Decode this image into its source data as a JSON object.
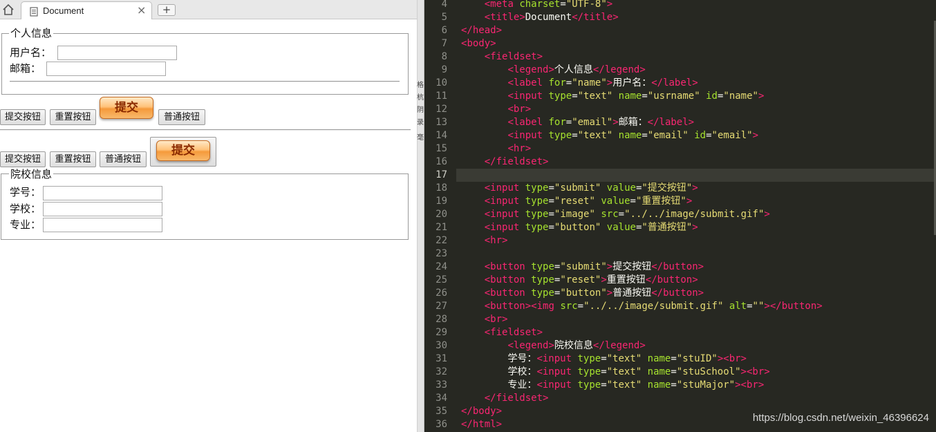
{
  "browser": {
    "tab_title": "Document",
    "tab_close": "×",
    "new_tab": "+",
    "page": {
      "personal": {
        "legend": "个人信息",
        "username_label": "用户名：",
        "username_value": "",
        "email_label": "邮箱：",
        "email_value": ""
      },
      "row1": {
        "submit": "提交按钮",
        "reset": "重置按钮",
        "image_text": "提交",
        "button": "普通按钮"
      },
      "row2": {
        "submit": "提交按钮",
        "reset": "重置按钮",
        "button": "普通按钮",
        "image_text": "提交"
      },
      "school": {
        "legend": "院校信息",
        "id_label": "学号：",
        "id_value": "",
        "school_label": "学校：",
        "school_value": "",
        "major_label": "专业：",
        "major_value": ""
      }
    }
  },
  "strip": [
    "格",
    "杭",
    "阴",
    "录",
    "毫"
  ],
  "editor": {
    "line_numbers": [
      "4",
      "5",
      "6",
      "7",
      "8",
      "9",
      "10",
      "11",
      "12",
      "13",
      "14",
      "15",
      "16",
      "17",
      "18",
      "19",
      "20",
      "21",
      "22",
      "23",
      "24",
      "25",
      "26",
      "27",
      "28",
      "29",
      "30",
      "31",
      "32",
      "33",
      "34",
      "35",
      "36"
    ],
    "active_line": "17",
    "lines": [
      [
        [
          "    ",
          "w"
        ],
        [
          "<",
          "tag"
        ],
        [
          "meta",
          "tag"
        ],
        [
          " ",
          "w"
        ],
        [
          "charset",
          "attr"
        ],
        [
          "=",
          "w"
        ],
        [
          "\"UTF-8\"",
          "str"
        ],
        [
          ">",
          "tag"
        ]
      ],
      [
        [
          "    ",
          "w"
        ],
        [
          "<",
          "tag"
        ],
        [
          "title",
          "tag"
        ],
        [
          ">",
          "tag"
        ],
        [
          "Document",
          "w"
        ],
        [
          "</",
          "tag"
        ],
        [
          "title",
          "tag"
        ],
        [
          ">",
          "tag"
        ]
      ],
      [
        [
          "</",
          "tag"
        ],
        [
          "head",
          "tag"
        ],
        [
          ">",
          "tag"
        ]
      ],
      [
        [
          "<",
          "tag"
        ],
        [
          "body",
          "tag"
        ],
        [
          ">",
          "tag"
        ]
      ],
      [
        [
          "    ",
          "w"
        ],
        [
          "<",
          "tag"
        ],
        [
          "fieldset",
          "tag"
        ],
        [
          ">",
          "tag"
        ]
      ],
      [
        [
          "        ",
          "w"
        ],
        [
          "<",
          "tag"
        ],
        [
          "legend",
          "tag"
        ],
        [
          ">",
          "tag"
        ],
        [
          "个人信息",
          "w"
        ],
        [
          "</",
          "tag"
        ],
        [
          "legend",
          "tag"
        ],
        [
          ">",
          "tag"
        ]
      ],
      [
        [
          "        ",
          "w"
        ],
        [
          "<",
          "tag"
        ],
        [
          "label",
          "tag"
        ],
        [
          " ",
          "w"
        ],
        [
          "for",
          "attr"
        ],
        [
          "=",
          "w"
        ],
        [
          "\"name\"",
          "str"
        ],
        [
          ">",
          "tag"
        ],
        [
          "用户名：",
          "w"
        ],
        [
          "</",
          "tag"
        ],
        [
          "label",
          "tag"
        ],
        [
          ">",
          "tag"
        ]
      ],
      [
        [
          "        ",
          "w"
        ],
        [
          "<",
          "tag"
        ],
        [
          "input",
          "tag"
        ],
        [
          " ",
          "w"
        ],
        [
          "type",
          "attr"
        ],
        [
          "=",
          "w"
        ],
        [
          "\"text\"",
          "str"
        ],
        [
          " ",
          "w"
        ],
        [
          "name",
          "attr"
        ],
        [
          "=",
          "w"
        ],
        [
          "\"usrname\"",
          "str"
        ],
        [
          " ",
          "w"
        ],
        [
          "id",
          "attr"
        ],
        [
          "=",
          "w"
        ],
        [
          "\"name\"",
          "str"
        ],
        [
          ">",
          "tag"
        ]
      ],
      [
        [
          "        ",
          "w"
        ],
        [
          "<",
          "tag"
        ],
        [
          "br",
          "tag"
        ],
        [
          ">",
          "tag"
        ]
      ],
      [
        [
          "        ",
          "w"
        ],
        [
          "<",
          "tag"
        ],
        [
          "label",
          "tag"
        ],
        [
          " ",
          "w"
        ],
        [
          "for",
          "attr"
        ],
        [
          "=",
          "w"
        ],
        [
          "\"email\"",
          "str"
        ],
        [
          ">",
          "tag"
        ],
        [
          "邮箱：",
          "w"
        ],
        [
          "</",
          "tag"
        ],
        [
          "label",
          "tag"
        ],
        [
          ">",
          "tag"
        ]
      ],
      [
        [
          "        ",
          "w"
        ],
        [
          "<",
          "tag"
        ],
        [
          "input",
          "tag"
        ],
        [
          " ",
          "w"
        ],
        [
          "type",
          "attr"
        ],
        [
          "=",
          "w"
        ],
        [
          "\"text\"",
          "str"
        ],
        [
          " ",
          "w"
        ],
        [
          "name",
          "attr"
        ],
        [
          "=",
          "w"
        ],
        [
          "\"email\"",
          "str"
        ],
        [
          " ",
          "w"
        ],
        [
          "id",
          "attr"
        ],
        [
          "=",
          "w"
        ],
        [
          "\"email\"",
          "str"
        ],
        [
          ">",
          "tag"
        ]
      ],
      [
        [
          "        ",
          "w"
        ],
        [
          "<",
          "tag"
        ],
        [
          "hr",
          "tag"
        ],
        [
          ">",
          "tag"
        ]
      ],
      [
        [
          "    ",
          "w"
        ],
        [
          "</",
          "tag"
        ],
        [
          "fieldset",
          "tag"
        ],
        [
          ">",
          "tag"
        ]
      ],
      [],
      [
        [
          "    ",
          "w"
        ],
        [
          "<",
          "tag"
        ],
        [
          "input",
          "tag"
        ],
        [
          " ",
          "w"
        ],
        [
          "type",
          "attr"
        ],
        [
          "=",
          "w"
        ],
        [
          "\"submit\"",
          "str"
        ],
        [
          " ",
          "w"
        ],
        [
          "value",
          "attr"
        ],
        [
          "=",
          "w"
        ],
        [
          "\"提交按钮\"",
          "str"
        ],
        [
          ">",
          "tag"
        ]
      ],
      [
        [
          "    ",
          "w"
        ],
        [
          "<",
          "tag"
        ],
        [
          "input",
          "tag"
        ],
        [
          " ",
          "w"
        ],
        [
          "type",
          "attr"
        ],
        [
          "=",
          "w"
        ],
        [
          "\"reset\"",
          "str"
        ],
        [
          " ",
          "w"
        ],
        [
          "value",
          "attr"
        ],
        [
          "=",
          "w"
        ],
        [
          "\"重置按钮\"",
          "str"
        ],
        [
          ">",
          "tag"
        ]
      ],
      [
        [
          "    ",
          "w"
        ],
        [
          "<",
          "tag"
        ],
        [
          "input",
          "tag"
        ],
        [
          " ",
          "w"
        ],
        [
          "type",
          "attr"
        ],
        [
          "=",
          "w"
        ],
        [
          "\"image\"",
          "str"
        ],
        [
          " ",
          "w"
        ],
        [
          "src",
          "attr"
        ],
        [
          "=",
          "w"
        ],
        [
          "\"../../image/submit.gif\"",
          "str"
        ],
        [
          ">",
          "tag"
        ]
      ],
      [
        [
          "    ",
          "w"
        ],
        [
          "<",
          "tag"
        ],
        [
          "input",
          "tag"
        ],
        [
          " ",
          "w"
        ],
        [
          "type",
          "attr"
        ],
        [
          "=",
          "w"
        ],
        [
          "\"button\"",
          "str"
        ],
        [
          " ",
          "w"
        ],
        [
          "value",
          "attr"
        ],
        [
          "=",
          "w"
        ],
        [
          "\"普通按钮\"",
          "str"
        ],
        [
          ">",
          "tag"
        ]
      ],
      [
        [
          "    ",
          "w"
        ],
        [
          "<",
          "tag"
        ],
        [
          "hr",
          "tag"
        ],
        [
          ">",
          "tag"
        ]
      ],
      [],
      [
        [
          "    ",
          "w"
        ],
        [
          "<",
          "tag"
        ],
        [
          "button",
          "tag"
        ],
        [
          " ",
          "w"
        ],
        [
          "type",
          "attr"
        ],
        [
          "=",
          "w"
        ],
        [
          "\"submit\"",
          "str"
        ],
        [
          ">",
          "tag"
        ],
        [
          "提交按钮",
          "w"
        ],
        [
          "</",
          "tag"
        ],
        [
          "button",
          "tag"
        ],
        [
          ">",
          "tag"
        ]
      ],
      [
        [
          "    ",
          "w"
        ],
        [
          "<",
          "tag"
        ],
        [
          "button",
          "tag"
        ],
        [
          " ",
          "w"
        ],
        [
          "type",
          "attr"
        ],
        [
          "=",
          "w"
        ],
        [
          "\"reset\"",
          "str"
        ],
        [
          ">",
          "tag"
        ],
        [
          "重置按钮",
          "w"
        ],
        [
          "</",
          "tag"
        ],
        [
          "button",
          "tag"
        ],
        [
          ">",
          "tag"
        ]
      ],
      [
        [
          "    ",
          "w"
        ],
        [
          "<",
          "tag"
        ],
        [
          "button",
          "tag"
        ],
        [
          " ",
          "w"
        ],
        [
          "type",
          "attr"
        ],
        [
          "=",
          "w"
        ],
        [
          "\"button\"",
          "str"
        ],
        [
          ">",
          "tag"
        ],
        [
          "普通按钮",
          "w"
        ],
        [
          "</",
          "tag"
        ],
        [
          "button",
          "tag"
        ],
        [
          ">",
          "tag"
        ]
      ],
      [
        [
          "    ",
          "w"
        ],
        [
          "<",
          "tag"
        ],
        [
          "button",
          "tag"
        ],
        [
          ">",
          "tag"
        ],
        [
          "<",
          "tag"
        ],
        [
          "img",
          "tag"
        ],
        [
          " ",
          "w"
        ],
        [
          "src",
          "attr"
        ],
        [
          "=",
          "w"
        ],
        [
          "\"../../image/submit.gif\"",
          "str"
        ],
        [
          " ",
          "w"
        ],
        [
          "alt",
          "attr"
        ],
        [
          "=",
          "w"
        ],
        [
          "\"\"",
          "str"
        ],
        [
          ">",
          "tag"
        ],
        [
          "</",
          "tag"
        ],
        [
          "button",
          "tag"
        ],
        [
          ">",
          "tag"
        ]
      ],
      [
        [
          "    ",
          "w"
        ],
        [
          "<",
          "tag"
        ],
        [
          "br",
          "tag"
        ],
        [
          ">",
          "tag"
        ]
      ],
      [
        [
          "    ",
          "w"
        ],
        [
          "<",
          "tag"
        ],
        [
          "fieldset",
          "tag"
        ],
        [
          ">",
          "tag"
        ]
      ],
      [
        [
          "        ",
          "w"
        ],
        [
          "<",
          "tag"
        ],
        [
          "legend",
          "tag"
        ],
        [
          ">",
          "tag"
        ],
        [
          "院校信息",
          "w"
        ],
        [
          "</",
          "tag"
        ],
        [
          "legend",
          "tag"
        ],
        [
          ">",
          "tag"
        ]
      ],
      [
        [
          "        ",
          "w"
        ],
        [
          "学号：",
          "w"
        ],
        [
          "<",
          "tag"
        ],
        [
          "input",
          "tag"
        ],
        [
          " ",
          "w"
        ],
        [
          "type",
          "attr"
        ],
        [
          "=",
          "w"
        ],
        [
          "\"text\"",
          "str"
        ],
        [
          " ",
          "w"
        ],
        [
          "name",
          "attr"
        ],
        [
          "=",
          "w"
        ],
        [
          "\"stuID\"",
          "str"
        ],
        [
          ">",
          "tag"
        ],
        [
          "<",
          "tag"
        ],
        [
          "br",
          "tag"
        ],
        [
          ">",
          "tag"
        ]
      ],
      [
        [
          "        ",
          "w"
        ],
        [
          "学校：",
          "w"
        ],
        [
          "<",
          "tag"
        ],
        [
          "input",
          "tag"
        ],
        [
          " ",
          "w"
        ],
        [
          "type",
          "attr"
        ],
        [
          "=",
          "w"
        ],
        [
          "\"text\"",
          "str"
        ],
        [
          " ",
          "w"
        ],
        [
          "name",
          "attr"
        ],
        [
          "=",
          "w"
        ],
        [
          "\"stuSchool\"",
          "str"
        ],
        [
          ">",
          "tag"
        ],
        [
          "<",
          "tag"
        ],
        [
          "br",
          "tag"
        ],
        [
          ">",
          "tag"
        ]
      ],
      [
        [
          "        ",
          "w"
        ],
        [
          "专业：",
          "w"
        ],
        [
          "<",
          "tag"
        ],
        [
          "input",
          "tag"
        ],
        [
          " ",
          "w"
        ],
        [
          "type",
          "attr"
        ],
        [
          "=",
          "w"
        ],
        [
          "\"text\"",
          "str"
        ],
        [
          " ",
          "w"
        ],
        [
          "name",
          "attr"
        ],
        [
          "=",
          "w"
        ],
        [
          "\"stuMajor\"",
          "str"
        ],
        [
          ">",
          "tag"
        ],
        [
          "<",
          "tag"
        ],
        [
          "br",
          "tag"
        ],
        [
          ">",
          "tag"
        ]
      ],
      [
        [
          "    ",
          "w"
        ],
        [
          "</",
          "tag"
        ],
        [
          "fieldset",
          "tag"
        ],
        [
          ">",
          "tag"
        ]
      ],
      [
        [
          "</",
          "tag"
        ],
        [
          "body",
          "tag"
        ],
        [
          ">",
          "tag"
        ]
      ],
      [
        [
          "</",
          "tag"
        ],
        [
          "html",
          "tag"
        ],
        [
          ">",
          "tag"
        ]
      ]
    ]
  },
  "watermark": "https://blog.csdn.net/weixin_46396624",
  "colors": {
    "editor_bg": "#272822",
    "tag": "#f92672",
    "attr": "#a6e22e",
    "string": "#e6db74",
    "text": "#f8f8f2",
    "line_number": "#8f908a",
    "image_button": "#f59a3b"
  }
}
